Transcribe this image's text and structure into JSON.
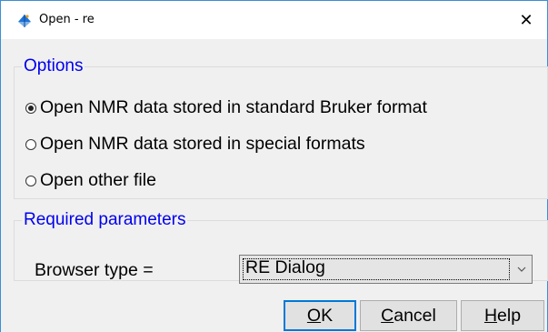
{
  "window": {
    "title": "Open - re",
    "close_glyph": "✕"
  },
  "options": {
    "legend": "Options",
    "radios": [
      {
        "label": "Open NMR data stored in standard Bruker format",
        "checked": true
      },
      {
        "label": "Open NMR data stored in special formats",
        "checked": false
      },
      {
        "label": "Open other file",
        "checked": false
      }
    ]
  },
  "params": {
    "legend": "Required parameters",
    "browser_type_label": "Browser type =",
    "browser_type_value": "RE Dialog"
  },
  "buttons": {
    "ok_first": "O",
    "ok_rest": "K",
    "cancel_first": "C",
    "cancel_rest": "ancel",
    "help_first": "H",
    "help_rest": "elp"
  },
  "colors": {
    "legend": "#0000ee",
    "window_border": "#3a8fd6",
    "default_button_border": "#0078d7",
    "icon_blue": "#1e73d8"
  },
  "icons": {
    "app": "topspin-icon",
    "close": "close-icon",
    "dropdown": "chevron-down-icon"
  }
}
